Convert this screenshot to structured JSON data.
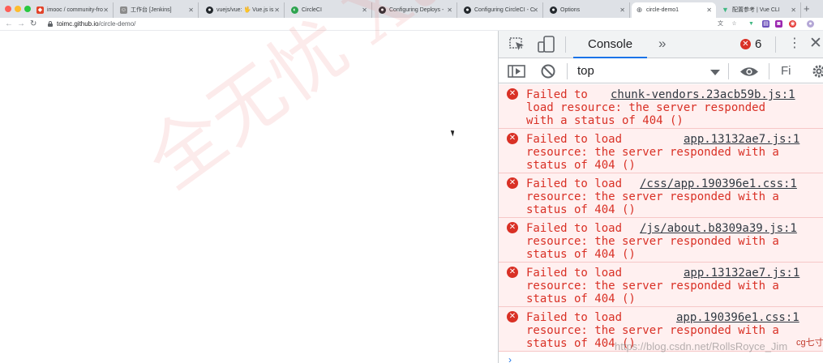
{
  "tabs": [
    {
      "label": "imooc / community-fro",
      "icon": "gitlab-icon",
      "color": "#e24329"
    },
    {
      "label": "工作台 [Jenkins]",
      "icon": "jenkins-icon",
      "color": "#8b8b8b"
    },
    {
      "label": "vuejs/vue: 🖖 Vue.js is",
      "icon": "github-icon",
      "color": "#24292e"
    },
    {
      "label": "CircleCI",
      "icon": "circleci-icon",
      "color": "#2ea44f"
    },
    {
      "label": "Configuring Deploys -",
      "icon": "github-icon",
      "color": "#24292e"
    },
    {
      "label": "Configuring CircleCI - C",
      "icon": "github-icon",
      "color": "#24292e"
    },
    {
      "label": "Options",
      "icon": "github-icon",
      "color": "#24292e"
    },
    {
      "label": "circle-demo1",
      "icon": "globe-icon",
      "color": "#5f6368"
    },
    {
      "label": "配置参考 | Vue CLI",
      "icon": "vue-icon",
      "color": "#41b883"
    }
  ],
  "address": {
    "host": "toimc.github.io",
    "path": "/circle-demo/"
  },
  "watermark": {
    "text": "全无忧 Xuetu Com"
  },
  "devtools": {
    "console_tab": "Console",
    "error_count": "6",
    "context": "top",
    "filter_placeholder": "Fi",
    "messages": [
      {
        "line1": "Failed to",
        "file": "chunk-vendors.23acb59b.js:1",
        "line2": "load resource: the server responded",
        "line3": "with a status of 404 ()"
      },
      {
        "line1": "Failed to load",
        "file": "app.13132ae7.js:1",
        "line2": "resource: the server responded with a",
        "line3": "status of 404 ()"
      },
      {
        "line1": "Failed to load",
        "file": "/css/app.190396e1.css:1",
        "line2": "resource: the server responded with a",
        "line3": "status of 404 ()"
      },
      {
        "line1": "Failed to load",
        "file": "/js/about.b8309a39.js:1",
        "line2": "resource: the server responded with a",
        "line3": "status of 404 ()"
      },
      {
        "line1": "Failed to load",
        "file": "app.13132ae7.js:1",
        "line2": "resource: the server responded with a",
        "line3": "status of 404 ()"
      },
      {
        "line1": "Failed to load",
        "file": "app.190396e1.css:1",
        "line2": "resource: the server responded with a",
        "line3": "status of 404 ()"
      }
    ]
  },
  "credit": "https://blog.csdn.net/RollsRoyce_Jim",
  "corner_mark": "cg七寸"
}
